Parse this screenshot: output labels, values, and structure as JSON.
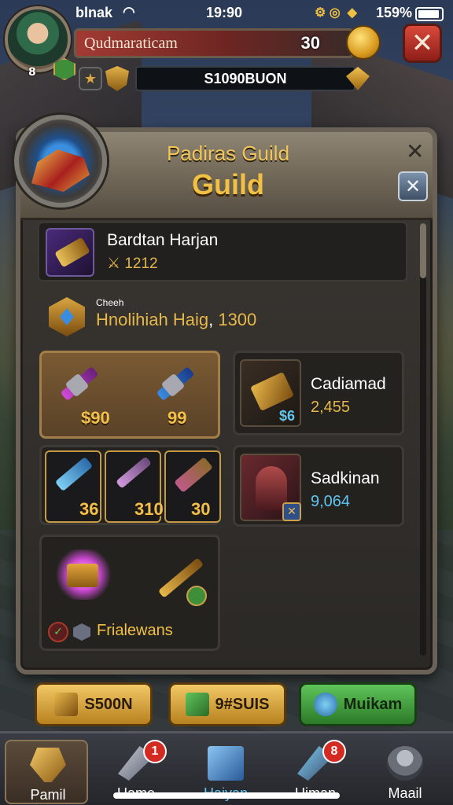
{
  "status_bar": {
    "carrier": "blnak",
    "time": "19:90",
    "battery_pct": "159%"
  },
  "hud": {
    "player_level": "8",
    "player_name": "Qudmaraticam",
    "gold_value": "30",
    "currency_text": "S1090BUON"
  },
  "guild": {
    "title": "Padiras Guild",
    "subtitle": "Guild"
  },
  "items": {
    "row1": {
      "title": "Bardtan Harjan",
      "value": "1212"
    },
    "row2": {
      "tiny": "Cheeh",
      "main": "Hnolihiah Haig",
      "value": "1300"
    },
    "card_a": {
      "left_value": "$90",
      "right_value": "99"
    },
    "card_b": {
      "name": "Cadiamad",
      "value": "2,455",
      "badge": "$6"
    },
    "card_c": {
      "v1": "36",
      "v2": "310",
      "v3": "30"
    },
    "card_d": {
      "name": "Sadkinan",
      "value": "9,064"
    },
    "card_e": {
      "label": "Frialewans"
    }
  },
  "actions": {
    "btn1": "S500N",
    "btn2": "9#SUIS",
    "btn3": "Muikam"
  },
  "tabs": [
    {
      "label": "Pamil",
      "badge": ""
    },
    {
      "label": "Uame",
      "badge": "1"
    },
    {
      "label": "Haiyan",
      "badge": ""
    },
    {
      "label": "Uiman",
      "badge": "8"
    },
    {
      "label": "Maail",
      "badge": ""
    }
  ],
  "colors": {
    "accent_gold": "#f2c144",
    "danger_red": "#d8493a",
    "success_green": "#5fc45a"
  }
}
